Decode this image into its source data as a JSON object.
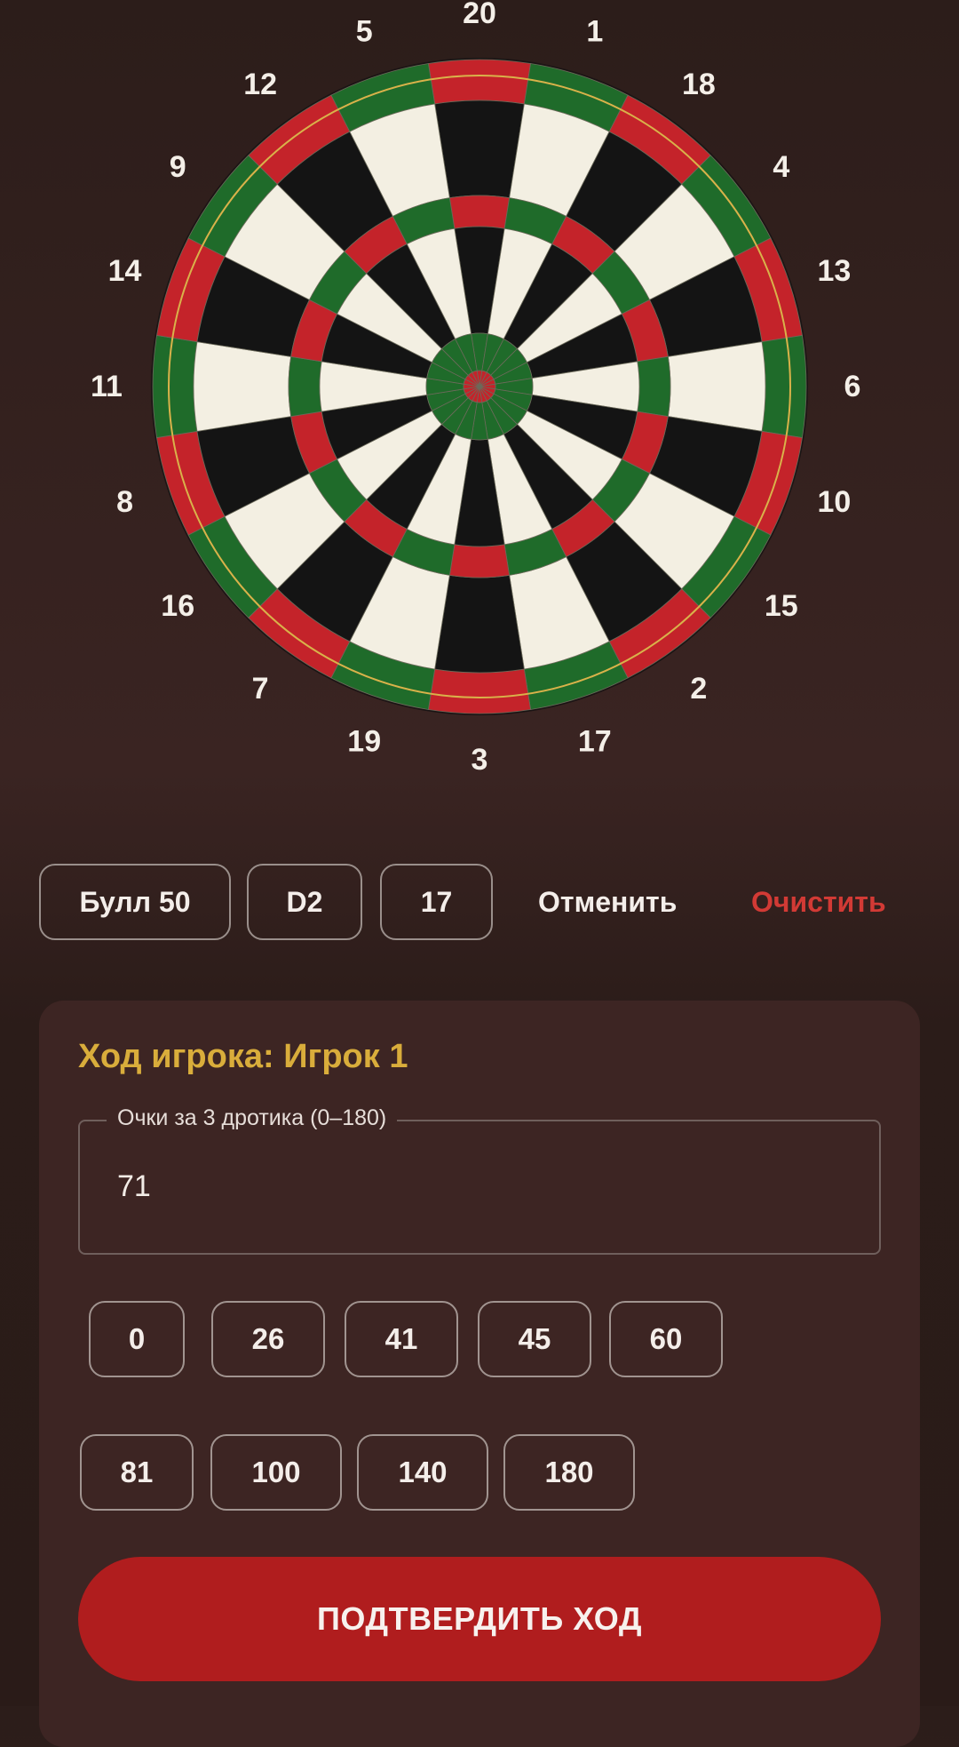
{
  "dartboard": {
    "numbers": [
      20,
      1,
      18,
      4,
      13,
      6,
      10,
      15,
      2,
      17,
      3,
      19,
      7,
      16,
      8,
      11,
      14,
      9,
      12,
      5
    ],
    "colors": {
      "black": "#141414",
      "cream": "#f3efe2",
      "red": "#c4232a",
      "green": "#1f6b2a",
      "wire": "#d9b24a"
    }
  },
  "selected_darts": {
    "chips": [
      "Булл 50",
      "D2",
      "17"
    ],
    "undo_label": "Отменить",
    "clear_label": "Очистить"
  },
  "turn": {
    "title": "Ход игрока: Игрок 1",
    "score_field_label": "Очки за 3 дротика (0–180)",
    "score_value": "71",
    "quick_scores_row1": [
      "0",
      "26",
      "41",
      "45",
      "60"
    ],
    "quick_scores_row2": [
      "81",
      "100",
      "140",
      "180"
    ],
    "confirm_label": "ПОДТВЕРДИТЬ ХОД"
  },
  "theme": {
    "accent_gold": "#d9ad3b",
    "danger_red": "#d23a35",
    "primary_button": "#b01d1e"
  }
}
